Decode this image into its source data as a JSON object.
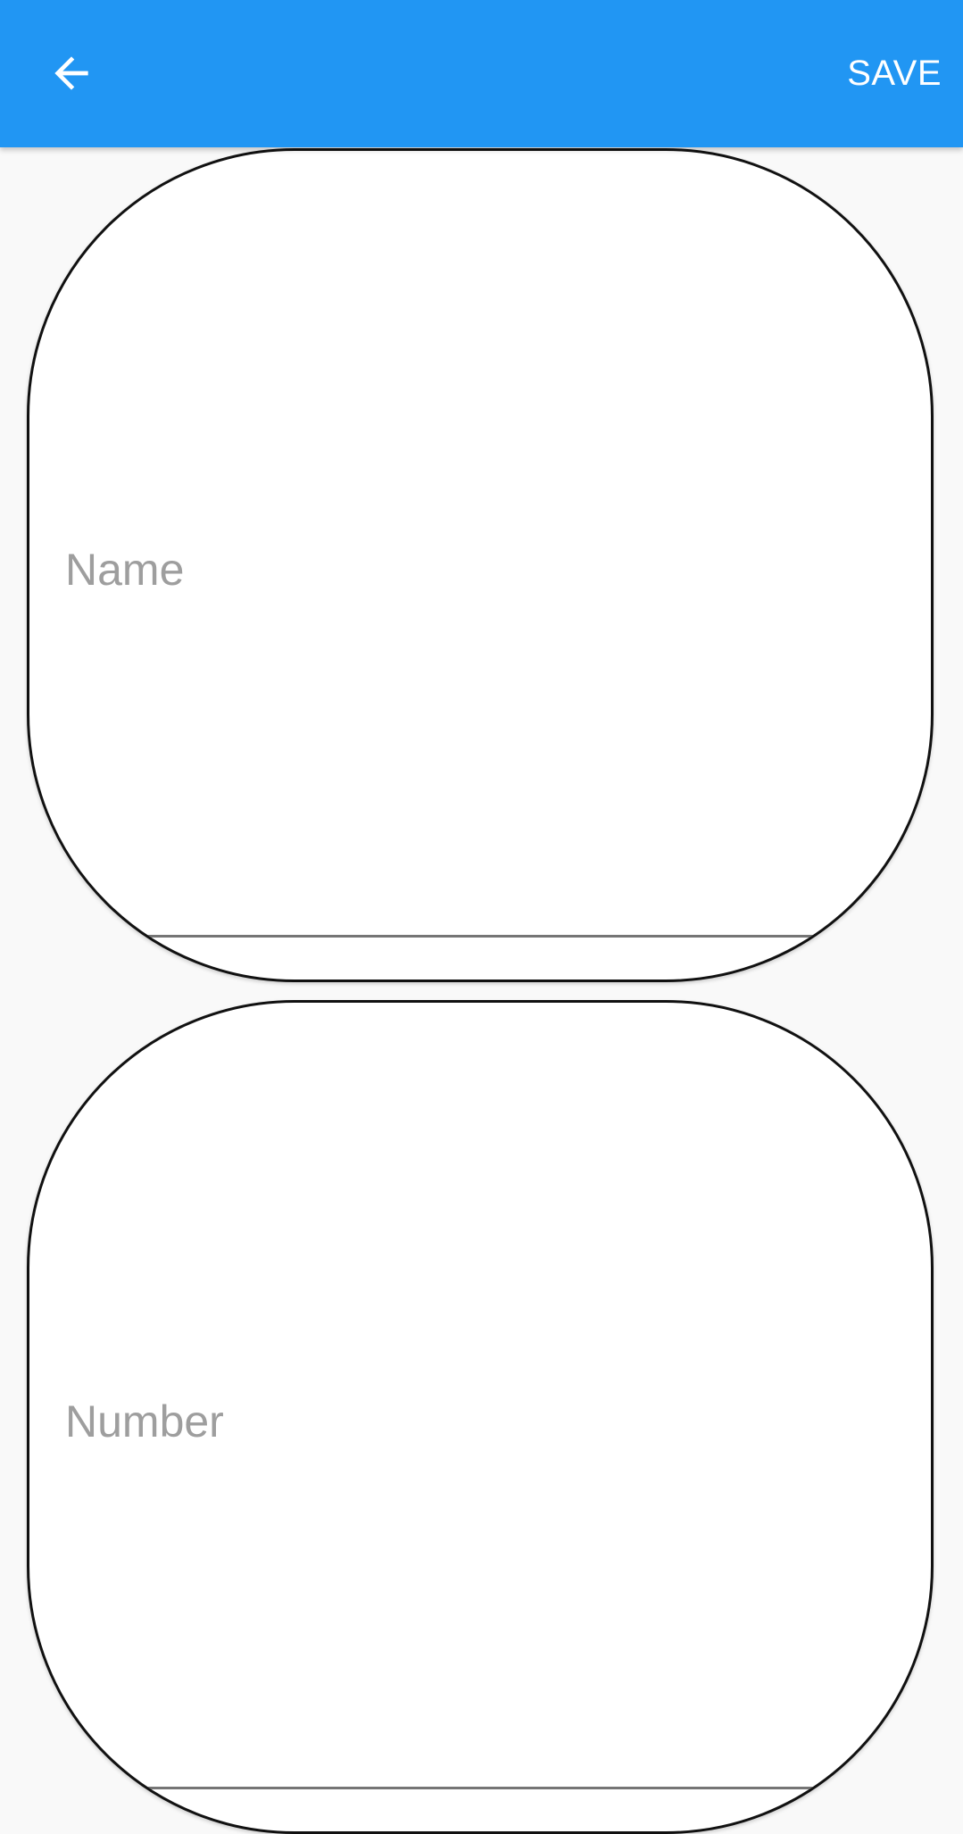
{
  "app_bar": {
    "back_icon": "arrow-left-icon",
    "save_label": "SAVE",
    "background": "#2196f3"
  },
  "form": {
    "name_field": {
      "label": "Name",
      "value": ""
    },
    "number_field": {
      "label": "Number",
      "value": ""
    }
  }
}
